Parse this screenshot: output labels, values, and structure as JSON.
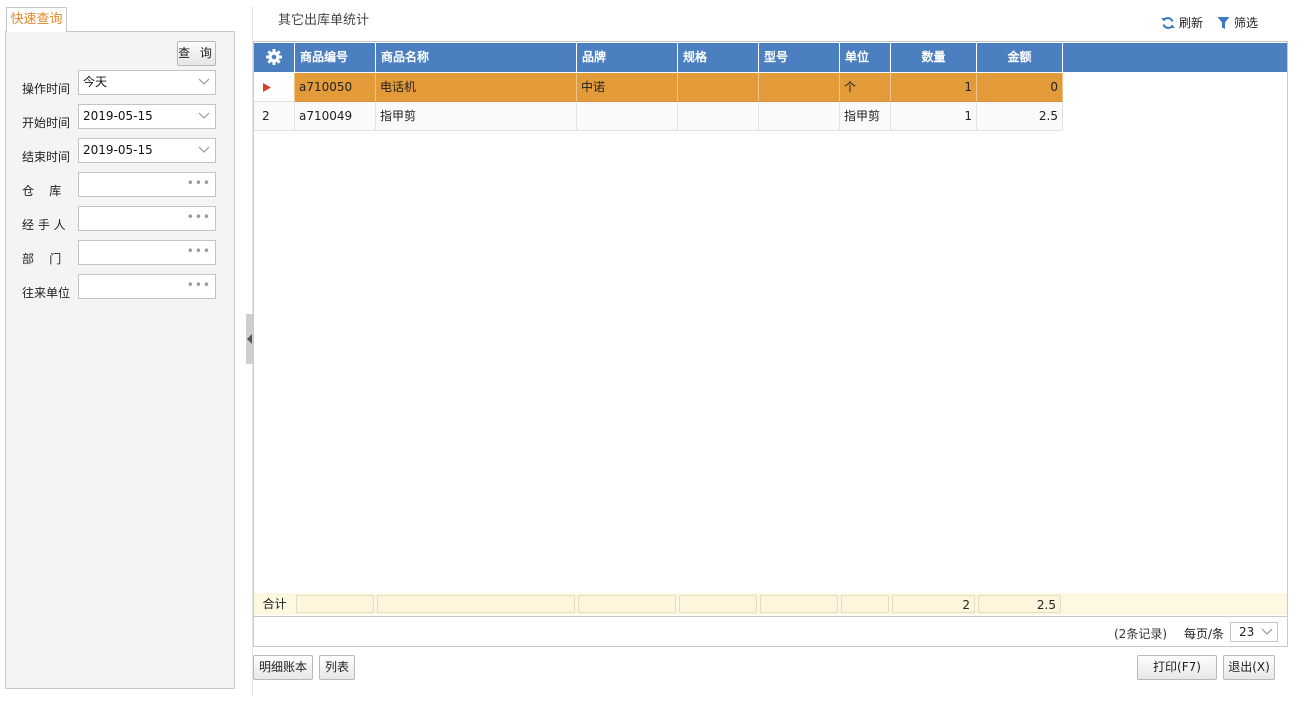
{
  "left_panel": {
    "tab_label": "快速查询",
    "query_button": "查 询",
    "fields": [
      {
        "label": "操作时间",
        "value": "今天",
        "kind": "dropdown"
      },
      {
        "label": "开始时间",
        "value": "2019-05-15",
        "kind": "dropdown"
      },
      {
        "label": "结束时间",
        "value": "2019-05-15",
        "kind": "dropdown"
      },
      {
        "label": "仓    库",
        "value": "",
        "kind": "picker"
      },
      {
        "label": "经 手 人",
        "value": "",
        "kind": "picker"
      },
      {
        "label": "部    门",
        "value": "",
        "kind": "picker"
      },
      {
        "label": "往来单位",
        "value": "",
        "kind": "picker"
      }
    ]
  },
  "header": {
    "title": "其它出库单统计",
    "refresh_label": "刷新",
    "filter_label": "筛选"
  },
  "grid": {
    "columns": [
      "商品编号",
      "商品名称",
      "品牌",
      "规格",
      "型号",
      "单位",
      "数量",
      "金额"
    ],
    "rows": [
      {
        "indicator": "",
        "code": "a710050",
        "name": "电话机",
        "brand": "中诺",
        "spec": "",
        "model": "",
        "unit": "个",
        "qty": "1",
        "amount": "0"
      },
      {
        "indicator": "2",
        "code": "a710049",
        "name": "指甲剪",
        "brand": "",
        "spec": "",
        "model": "",
        "unit": "指甲剪",
        "qty": "1",
        "amount": "2.5"
      }
    ],
    "summary": {
      "label": "合计",
      "qty": "2",
      "amount": "2.5"
    },
    "pager": {
      "records": "(2条记录)",
      "per_page_label": "每页/条",
      "per_page_value": "23"
    }
  },
  "footer": {
    "detail_ledger": "明细账本",
    "list": "列表",
    "print": "打印(F7)",
    "exit": "退出(X)"
  },
  "colors": {
    "header_blue": "#4b7fc0",
    "selected_row": "#e39b3a",
    "accent_orange": "#e5892b",
    "summary_bg": "#fdf8e1"
  }
}
